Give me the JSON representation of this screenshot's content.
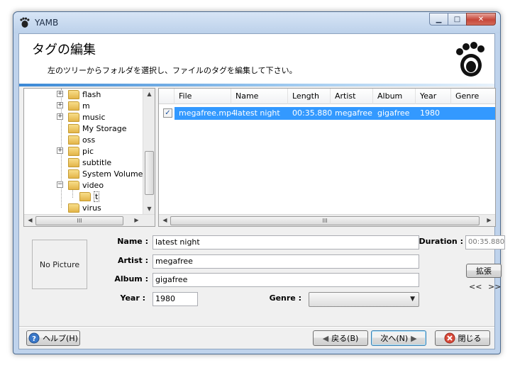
{
  "window": {
    "title": "YAMB",
    "controls": {
      "minimize": "▁",
      "maximize": "□",
      "close": "✕"
    }
  },
  "header": {
    "title": "タグの編集",
    "description": "左のツリーからフォルダを選択し、ファイルのタグを編集して下さい。"
  },
  "tree": {
    "items": [
      {
        "label": "flash",
        "expander": "+"
      },
      {
        "label": "m",
        "expander": "+"
      },
      {
        "label": "music",
        "expander": "+"
      },
      {
        "label": "My Storage",
        "expander": ""
      },
      {
        "label": "oss",
        "expander": ""
      },
      {
        "label": "pic",
        "expander": "+"
      },
      {
        "label": "subtitle",
        "expander": ""
      },
      {
        "label": "System Volume In",
        "expander": ""
      },
      {
        "label": "video",
        "expander": "−"
      },
      {
        "label": "t",
        "expander": ""
      },
      {
        "label": "virus",
        "expander": ""
      }
    ],
    "scroll_up": "▲",
    "scroll_down": "▼",
    "scroll_left": "◀",
    "scroll_right": "▶",
    "grip": "III"
  },
  "list": {
    "columns": [
      "File",
      "Name",
      "Length",
      "Artist",
      "Album",
      "Year",
      "Genre"
    ],
    "rows": [
      {
        "checked": "✓",
        "file": "megafree.mp4",
        "name": "latest night",
        "length": "00:35.880",
        "artist": "megafree",
        "album": "gigafree",
        "year": "1980",
        "genre": ""
      }
    ],
    "scroll_left": "◀",
    "scroll_right": "▶",
    "grip": "III"
  },
  "details": {
    "no_picture": "No Picture",
    "name_label": "Name :",
    "name_value": "latest night",
    "artist_label": "Artist :",
    "artist_value": "megafree",
    "album_label": "Album :",
    "album_value": "gigafree",
    "year_label": "Year :",
    "year_value": "1980",
    "genre_label": "Genre :",
    "genre_value": "",
    "duration_label": "Duration :",
    "duration_value": "00:35.880",
    "expand_button": "拡張",
    "prev_arrows": "<<",
    "next_arrows": ">>"
  },
  "footer": {
    "help_label": "ヘルプ(H)",
    "back_label": "戻る(B)",
    "next_label": "次へ(N)",
    "close_label": "閉じる"
  },
  "colors": {
    "selection": "#3399ff",
    "accent_line": "#3b89d6",
    "close_button": "#c6473a"
  }
}
